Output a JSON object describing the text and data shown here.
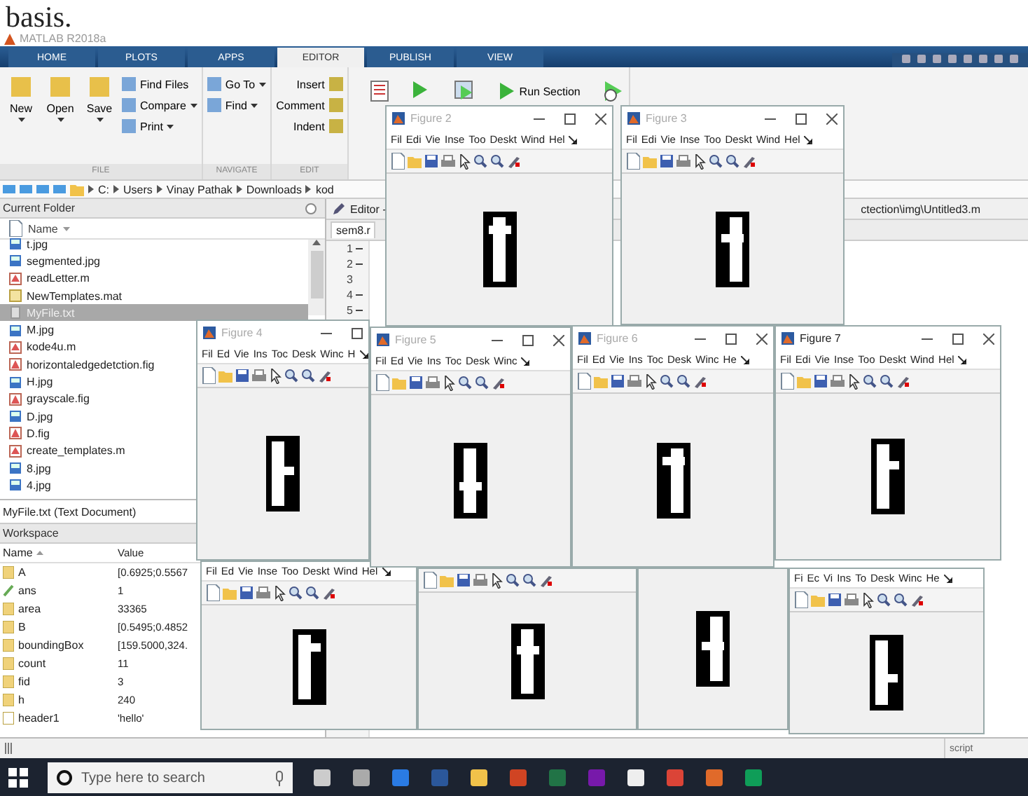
{
  "page_caption": "basis.",
  "app": {
    "title": "MATLAB R2018a"
  },
  "tabs": [
    {
      "label": "HOME",
      "selected": false
    },
    {
      "label": "PLOTS",
      "selected": false
    },
    {
      "label": "APPS",
      "selected": false
    },
    {
      "label": "EDITOR",
      "selected": true
    },
    {
      "label": "PUBLISH",
      "selected": false
    },
    {
      "label": "VIEW",
      "selected": false
    }
  ],
  "ribbon": [
    {
      "label": "FILE",
      "buttons": [
        {
          "label": "New",
          "kind": "big"
        },
        {
          "label": "Open",
          "kind": "big"
        },
        {
          "label": "Save",
          "kind": "big"
        },
        {
          "label": "Find Files",
          "kind": "small",
          "dropdown": false
        },
        {
          "label": "Compare",
          "kind": "small",
          "dropdown": true
        },
        {
          "label": "Print",
          "kind": "small",
          "dropdown": true
        }
      ]
    },
    {
      "label": "NAVIGATE",
      "buttons": [
        {
          "label": "Go To",
          "kind": "small",
          "dropdown": true
        },
        {
          "label": "Find",
          "kind": "small",
          "dropdown": true
        }
      ]
    },
    {
      "label": "EDIT",
      "buttons": [
        {
          "label": "Insert",
          "kind": "row"
        },
        {
          "label": "Comment",
          "kind": "row"
        },
        {
          "label": "Indent",
          "kind": "row"
        }
      ]
    },
    {
      "buttons": [
        {
          "label": "Run Section",
          "kind": "run"
        }
      ]
    }
  ],
  "address": [
    "C:",
    "Users",
    "Vinay Pathak",
    "Downloads",
    "kod"
  ],
  "current_folder": {
    "title": "Current Folder",
    "column": "Name",
    "files": [
      {
        "name": "t.jpg",
        "kind": "image",
        "selected": false
      },
      {
        "name": "segmented.jpg",
        "kind": "image",
        "selected": false
      },
      {
        "name": "readLetter.m",
        "kind": "script",
        "selected": false
      },
      {
        "name": "NewTemplates.mat",
        "kind": "data",
        "selected": false
      },
      {
        "name": "MyFile.txt",
        "kind": "text",
        "selected": true
      },
      {
        "name": "M.jpg",
        "kind": "image",
        "selected": false
      },
      {
        "name": "kode4u.m",
        "kind": "script",
        "selected": false
      },
      {
        "name": "horizontaledgedetction.fig",
        "kind": "figure",
        "selected": false
      },
      {
        "name": "H.jpg",
        "kind": "image",
        "selected": false
      },
      {
        "name": "grayscale.fig",
        "kind": "figure",
        "selected": false
      },
      {
        "name": "D.jpg",
        "kind": "image",
        "selected": false
      },
      {
        "name": "D.fig",
        "kind": "figure",
        "selected": false
      },
      {
        "name": "create_templates.m",
        "kind": "script",
        "selected": false
      },
      {
        "name": "8.jpg",
        "kind": "image",
        "selected": false
      },
      {
        "name": "4.jpg",
        "kind": "image",
        "selected": false
      }
    ],
    "details": "MyFile.txt  (Text Document)"
  },
  "workspace": {
    "title": "Workspace",
    "columns": [
      "Name",
      "Value"
    ],
    "rows": [
      {
        "name": "A",
        "value": "[0.6925;0.5567",
        "kind": "matrix"
      },
      {
        "name": "ans",
        "value": "1",
        "kind": "logical"
      },
      {
        "name": "area",
        "value": "33365",
        "kind": "matrix"
      },
      {
        "name": "B",
        "value": "[0.5495;0.4852",
        "kind": "matrix"
      },
      {
        "name": "boundingBox",
        "value": "[159.5000,324.",
        "kind": "matrix"
      },
      {
        "name": "count",
        "value": "11",
        "kind": "matrix"
      },
      {
        "name": "fid",
        "value": "3",
        "kind": "matrix"
      },
      {
        "name": "h",
        "value": "240",
        "kind": "matrix"
      },
      {
        "name": "header1",
        "value": "'hello'",
        "kind": "char"
      }
    ]
  },
  "editor": {
    "title": "Editor -",
    "tab": "sem8.r",
    "path": "ctection\\img\\Untitled3.m",
    "line_numbers": [
      {
        "label": "1",
        "executable": true
      },
      {
        "label": "2",
        "executable": true
      },
      {
        "label": "3",
        "executable": false
      },
      {
        "label": "4",
        "executable": true
      },
      {
        "label": "5",
        "executable": true
      }
    ]
  },
  "status_text": "script",
  "figures": [
    {
      "menus": [
        "Fil",
        "Ed",
        "Vie",
        "Inse",
        "Too",
        "Deskt",
        "Wind",
        "Hel"
      ],
      "toolbar": true
    },
    {
      "toolbar": true
    },
    {
      "toolbar": false
    },
    {
      "menus": [
        "Fi",
        "Ec",
        "Vi",
        "Ins",
        "To",
        "Desk",
        "Winc",
        "He"
      ],
      "toolbar": true
    },
    {
      "title": "Figure 2",
      "active": false,
      "menus": [
        "Fil",
        "Edi",
        "Vie",
        "Inse",
        "Too",
        "Deskt",
        "Wind",
        "Hel"
      ],
      "toolbar": true
    },
    {
      "title": "Figure 3",
      "active": false,
      "menus": [
        "Fil",
        "Edi",
        "Vie",
        "Inse",
        "Too",
        "Deskt",
        "Wind",
        "Hel"
      ],
      "toolbar": true
    },
    {
      "title": "Figure 4",
      "active": false,
      "menus": [
        "Fil",
        "Ed",
        "Vie",
        "Ins",
        "Toc",
        "Desk",
        "Winc",
        "H"
      ],
      "toolbar": true
    },
    {
      "title": "Figure 5",
      "active": false,
      "menus": [
        "Fil",
        "Ed",
        "Vie",
        "Ins",
        "Toc",
        "Desk",
        "Winc"
      ],
      "toolbar": true
    },
    {
      "title": "Figure 6",
      "active": false,
      "menus": [
        "Fil",
        "Ed",
        "Vie",
        "Ins",
        "Toc",
        "Desk",
        "Winc",
        "He"
      ],
      "toolbar": true
    },
    {
      "title": "Figure 7",
      "active": true,
      "menus": [
        "Fil",
        "Edi",
        "Vie",
        "Inse",
        "Too",
        "Deskt",
        "Wind",
        "Hel"
      ],
      "toolbar": true
    }
  ],
  "taskbar": {
    "search_placeholder": "Type here to search"
  }
}
